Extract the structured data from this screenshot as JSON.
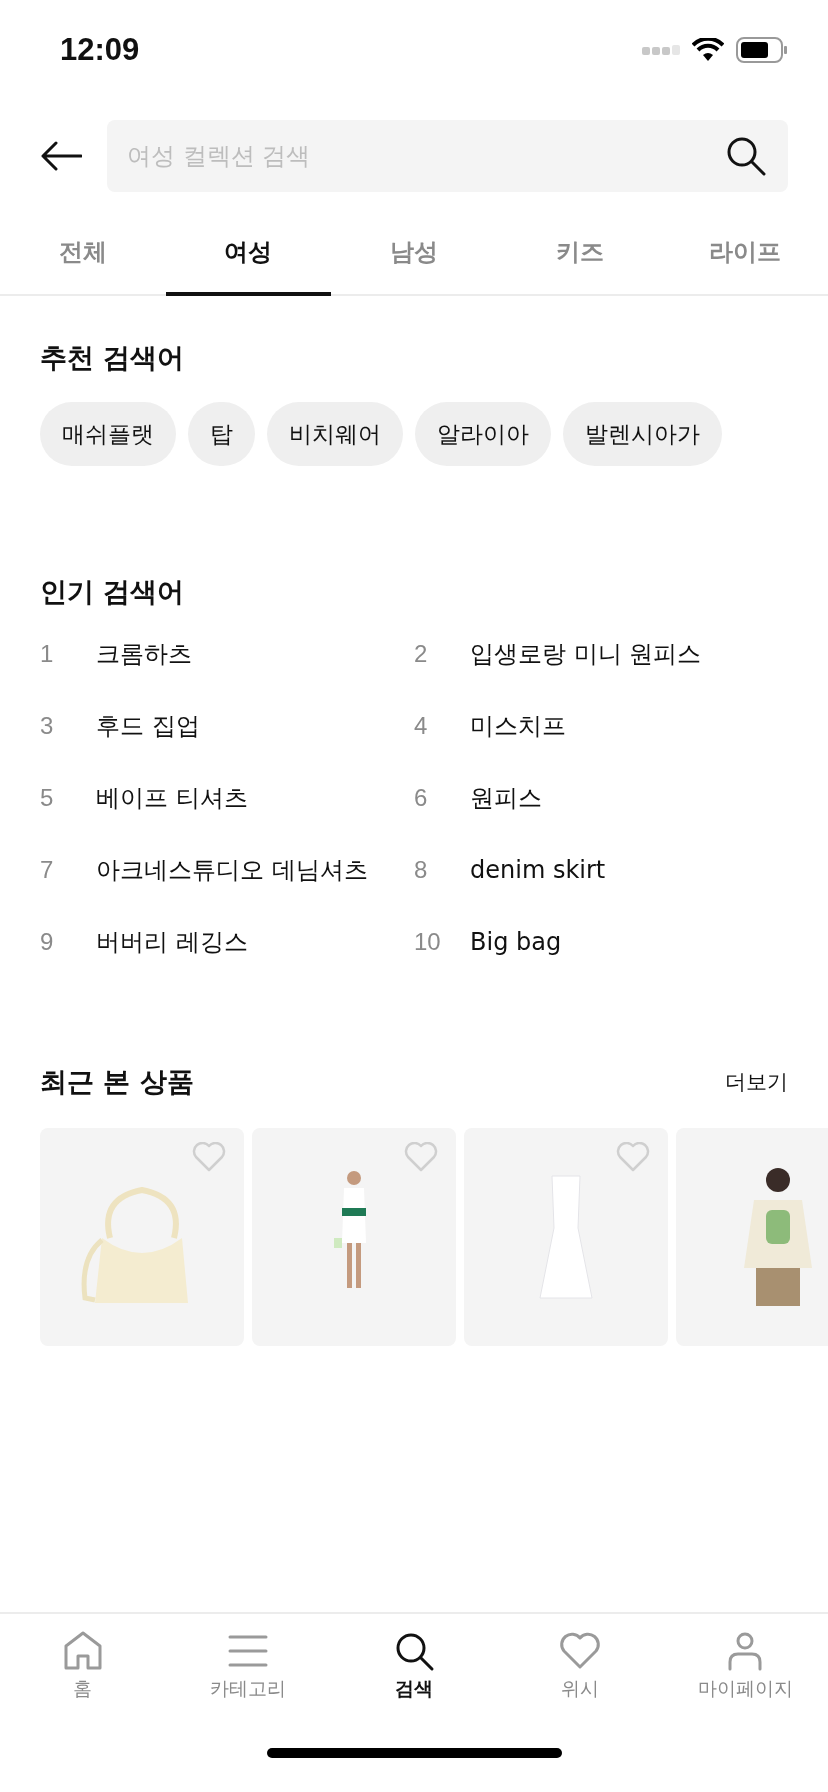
{
  "status_bar": {
    "time": "12:09"
  },
  "search": {
    "placeholder": "여성 컬렉션 검색"
  },
  "tabs": [
    {
      "label": "전체",
      "selected": false
    },
    {
      "label": "여성",
      "selected": true
    },
    {
      "label": "남성",
      "selected": false
    },
    {
      "label": "키즈",
      "selected": false
    },
    {
      "label": "라이프",
      "selected": false
    }
  ],
  "recommended": {
    "title": "추천 검색어",
    "keywords": [
      "매쉬플랫",
      "탑",
      "비치웨어",
      "알라이아",
      "발렌시아가"
    ]
  },
  "popular": {
    "title": "인기 검색어",
    "items": [
      {
        "rank": "1",
        "term": "크롬하츠"
      },
      {
        "rank": "2",
        "term": "입생로랑 미니 원피스"
      },
      {
        "rank": "3",
        "term": "후드 집업"
      },
      {
        "rank": "4",
        "term": "미스치프"
      },
      {
        "rank": "5",
        "term": "베이프 티셔츠"
      },
      {
        "rank": "6",
        "term": "원피스"
      },
      {
        "rank": "7",
        "term": "아크네스튜디오 데님셔츠"
      },
      {
        "rank": "8",
        "term": "denim skirt"
      },
      {
        "rank": "9",
        "term": "버버리 레깅스"
      },
      {
        "rank": "10",
        "term": "Big bag"
      }
    ]
  },
  "recent": {
    "title": "최근 본 상품",
    "more": "더보기"
  },
  "bottom_nav": [
    {
      "label": "홈",
      "selected": false
    },
    {
      "label": "카테고리",
      "selected": false
    },
    {
      "label": "검색",
      "selected": true
    },
    {
      "label": "위시",
      "selected": false
    },
    {
      "label": "마이페이지",
      "selected": false
    }
  ]
}
